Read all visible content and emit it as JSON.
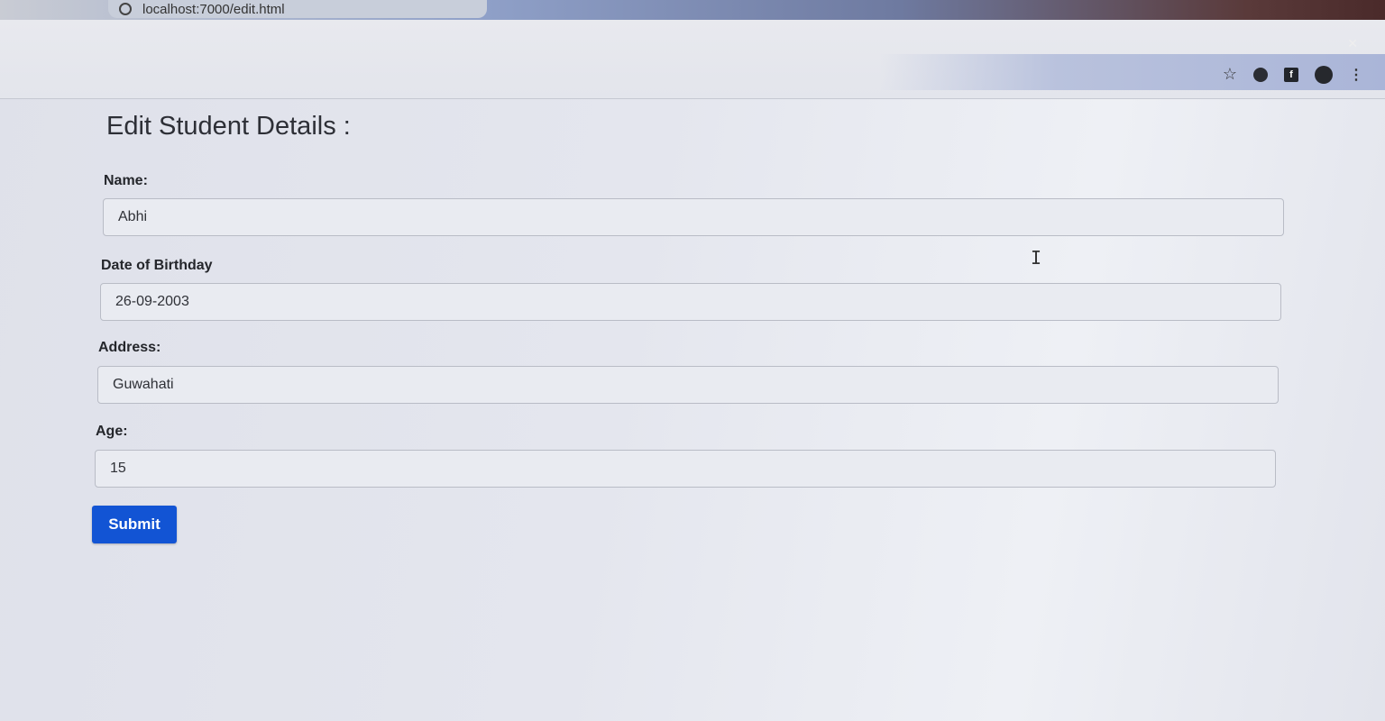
{
  "browser": {
    "url": "localhost:7000/edit.html",
    "icons": [
      "info-icon",
      "star-icon",
      "extension-icon",
      "flipboard-icon",
      "profile-avatar-icon",
      "menu-kebab-icon"
    ]
  },
  "form": {
    "title": "Edit Student Details :",
    "fields": [
      {
        "label": "Name:",
        "value": "Abhi"
      },
      {
        "label": "Date of Birthday",
        "value": "26-09-2003"
      },
      {
        "label": "Address:",
        "value": "Guwahati"
      },
      {
        "label": "Age:",
        "value": "15"
      }
    ],
    "submit_label": "Submit"
  },
  "colors": {
    "submit_bg": "#1254d4",
    "page_bg": "#e4e6ee"
  }
}
